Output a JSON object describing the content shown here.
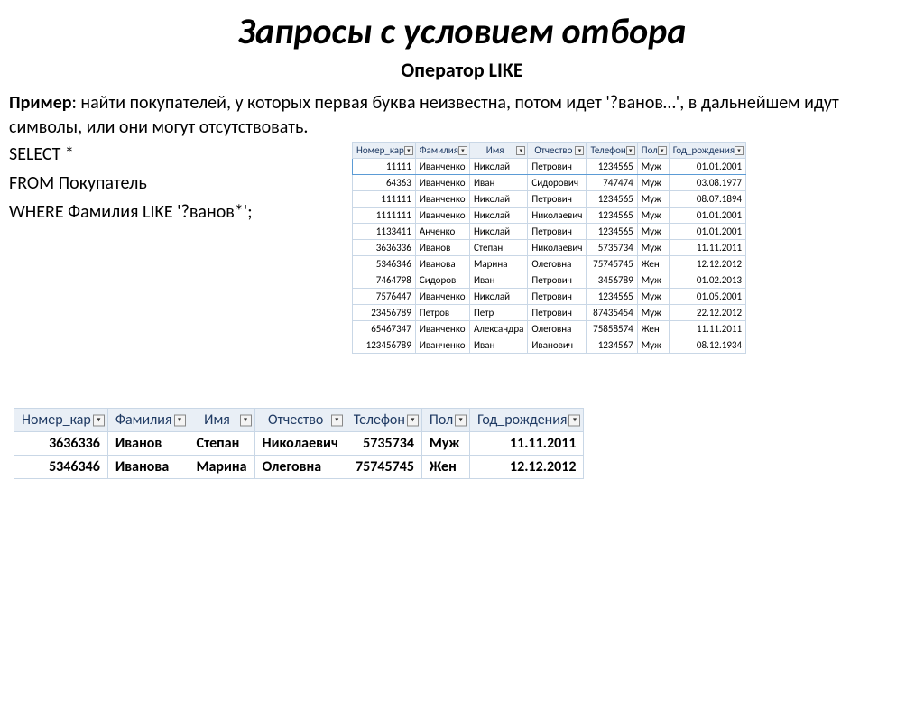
{
  "title": "Запросы с условием отбора",
  "subtitle": "Оператор LIKE",
  "example_label": "Пример",
  "example_text": ": найти покупателей, у которых первая буква неизвестна, потом идет '?ванов…', в дальнейшем идут символы, или они могут отсутствовать.",
  "sql": {
    "line1": "SELECT *",
    "line2": "FROM Покупатель",
    "line3": "WHERE Фамилия LIKE '?ванов*';"
  },
  "source_table": {
    "columns": [
      "Номер_кар",
      "Фамилия",
      "Имя",
      "Отчество",
      "Телефон",
      "Пол",
      "Год_рождения"
    ],
    "rows": [
      {
        "num": "11111",
        "fam": "Иванченко",
        "name": "Николай",
        "pat": "Петрович",
        "tel": "1234565",
        "sex": "Муж",
        "dob": "01.01.2001",
        "selected": true
      },
      {
        "num": "64363",
        "fam": "Иванченко",
        "name": "Иван",
        "pat": "Сидорович",
        "tel": "747474",
        "sex": "Муж",
        "dob": "03.08.1977"
      },
      {
        "num": "111111",
        "fam": "Иванченко",
        "name": "Николай",
        "pat": "Петрович",
        "tel": "1234565",
        "sex": "Муж",
        "dob": "08.07.1894"
      },
      {
        "num": "1111111",
        "fam": "Иванченко",
        "name": "Николай",
        "pat": "Николаевич",
        "tel": "1234565",
        "sex": "Муж",
        "dob": "01.01.2001"
      },
      {
        "num": "1133411",
        "fam": "Анченко",
        "name": "Николай",
        "pat": "Петрович",
        "tel": "1234565",
        "sex": "Муж",
        "dob": "01.01.2001"
      },
      {
        "num": "3636336",
        "fam": "Иванов",
        "name": "Степан",
        "pat": "Николаевич",
        "tel": "5735734",
        "sex": "Муж",
        "dob": "11.11.2011"
      },
      {
        "num": "5346346",
        "fam": "Иванова",
        "name": "Марина",
        "pat": "Олеговна",
        "tel": "75745745",
        "sex": "Жен",
        "dob": "12.12.2012"
      },
      {
        "num": "7464798",
        "fam": "Сидоров",
        "name": "Иван",
        "pat": "Петрович",
        "tel": "3456789",
        "sex": "Муж",
        "dob": "01.02.2013"
      },
      {
        "num": "7576447",
        "fam": "Иванченко",
        "name": "Николай",
        "pat": "Петрович",
        "tel": "1234565",
        "sex": "Муж",
        "dob": "01.05.2001"
      },
      {
        "num": "23456789",
        "fam": "Петров",
        "name": "Петр",
        "pat": "Петрович",
        "tel": "87435454",
        "sex": "Муж",
        "dob": "22.12.2012"
      },
      {
        "num": "65467347",
        "fam": "Иванченко",
        "name": "Александра",
        "pat": "Олеговна",
        "tel": "75858574",
        "sex": "Жен",
        "dob": "11.11.2011"
      },
      {
        "num": "123456789",
        "fam": "Иванченко",
        "name": "Иван",
        "pat": "Иванович",
        "tel": "1234567",
        "sex": "Муж",
        "dob": "08.12.1934"
      }
    ]
  },
  "result_table": {
    "columns": [
      "Номер_кар",
      "Фамилия",
      "Имя",
      "Отчество",
      "Телефон",
      "Пол",
      "Год_рождения"
    ],
    "rows": [
      {
        "num": "3636336",
        "fam": "Иванов",
        "name": "Степан",
        "pat": "Николаевич",
        "tel": "5735734",
        "sex": "Муж",
        "dob": "11.11.2011"
      },
      {
        "num": "5346346",
        "fam": "Иванова",
        "name": "Марина",
        "pat": "Олеговна",
        "tel": "75745745",
        "sex": "Жен",
        "dob": "12.12.2012"
      }
    ]
  }
}
